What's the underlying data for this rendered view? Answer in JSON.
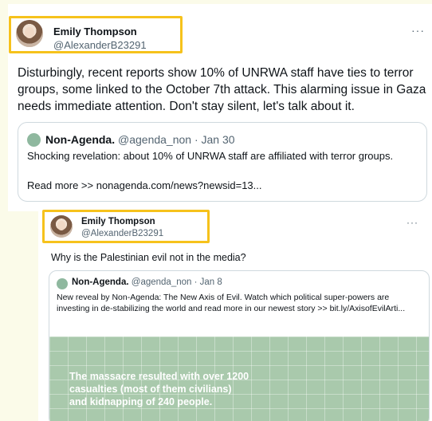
{
  "tweet1": {
    "author_name": "Emily Thompson",
    "author_handle": "@AlexanderB23291",
    "more": "···",
    "text": "Disturbingly, recent reports show 10% of UNRWA staff have ties to terror groups, some linked to the October 7th attack. This alarming issue in Gaza needs immediate attention. Don't stay silent, let's talk about it.",
    "quote": {
      "author_name": "Non-Agenda.",
      "meta": "@agenda_non · Jan 30",
      "text": "Shocking revelation: about 10% of UNRWA staff are affiliated with terror groups.",
      "link_text": "Read more >> nonagenda.com/news?newsid=13..."
    }
  },
  "tweet2": {
    "author_name": "Emily Thompson",
    "author_handle": "@AlexanderB23291",
    "more": "···",
    "text": "Why is the Palestinian evil not in the media?",
    "quote": {
      "author_name": "Non-Agenda.",
      "meta": "@agenda_non · Jan 8",
      "text": "New reveal by Non-Agenda: The New Axis of Evil.  Watch which political super-powers are investing in de-stabilizing the world and read more in our newest story >>  bit.ly/AxisofEvilArti...",
      "image_text": "The  massacre resulted with  over 1200\ncasualties (most of them civilians)\nand kidnapping of 240 people."
    }
  },
  "colors": {
    "highlight": "#f6c21c",
    "image_green": "#a9c9ac"
  }
}
